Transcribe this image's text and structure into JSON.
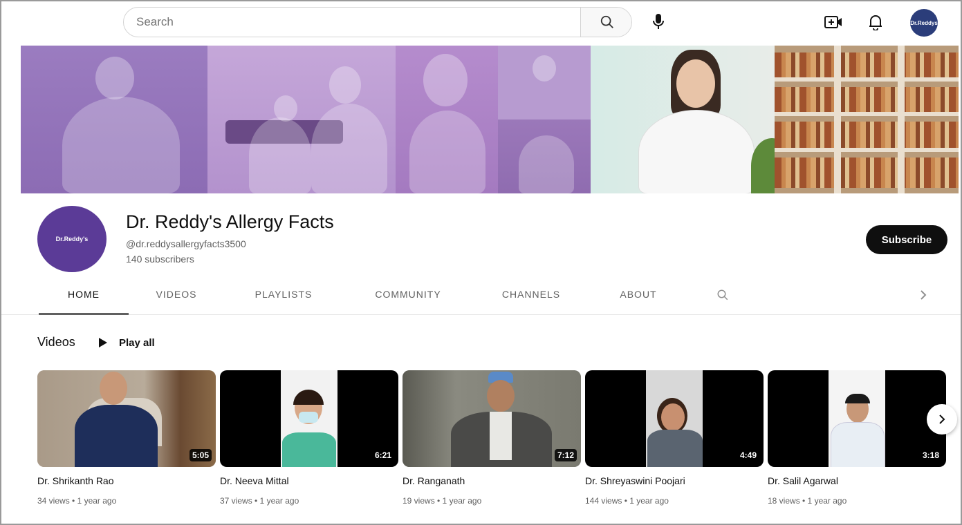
{
  "topbar": {
    "search_placeholder": "Search",
    "avatar_text": "Dr.Reddys"
  },
  "channel": {
    "title": "Dr. Reddy's Allergy Facts",
    "handle": "@dr.reddysallergyfacts3500",
    "subscribers": "140 subscribers",
    "avatar_text": "Dr.Reddy's",
    "subscribe_label": "Subscribe"
  },
  "tabs": [
    {
      "label": "HOME"
    },
    {
      "label": "VIDEOS"
    },
    {
      "label": "PLAYLISTS"
    },
    {
      "label": "COMMUNITY"
    },
    {
      "label": "CHANNELS"
    },
    {
      "label": "ABOUT"
    }
  ],
  "videos_section": {
    "title": "Videos",
    "play_all_label": "Play all"
  },
  "videos": [
    {
      "title": "Dr. Shrikanth Rao",
      "duration": "5:05",
      "meta": "34 views • 1 year ago"
    },
    {
      "title": "Dr. Neeva Mittal",
      "duration": "6:21",
      "meta": "37 views • 1 year ago"
    },
    {
      "title": "Dr. Ranganath",
      "duration": "7:12",
      "meta": "19 views • 1 year ago"
    },
    {
      "title": "Dr. Shreyaswini Poojari",
      "duration": "4:49",
      "meta": "144 views • 1 year ago"
    },
    {
      "title": "Dr. Salil Agarwal",
      "duration": "3:18",
      "meta": "18 views • 1 year ago"
    }
  ],
  "colors": {
    "banner_purple": "#9b7cc0",
    "channel_avatar": "#5b3b97",
    "subscribe_bg": "#0f0f0f"
  },
  "icons": [
    "search-icon",
    "mic-icon",
    "create-video-icon",
    "bell-icon",
    "play-icon",
    "chevron-right-icon"
  ]
}
